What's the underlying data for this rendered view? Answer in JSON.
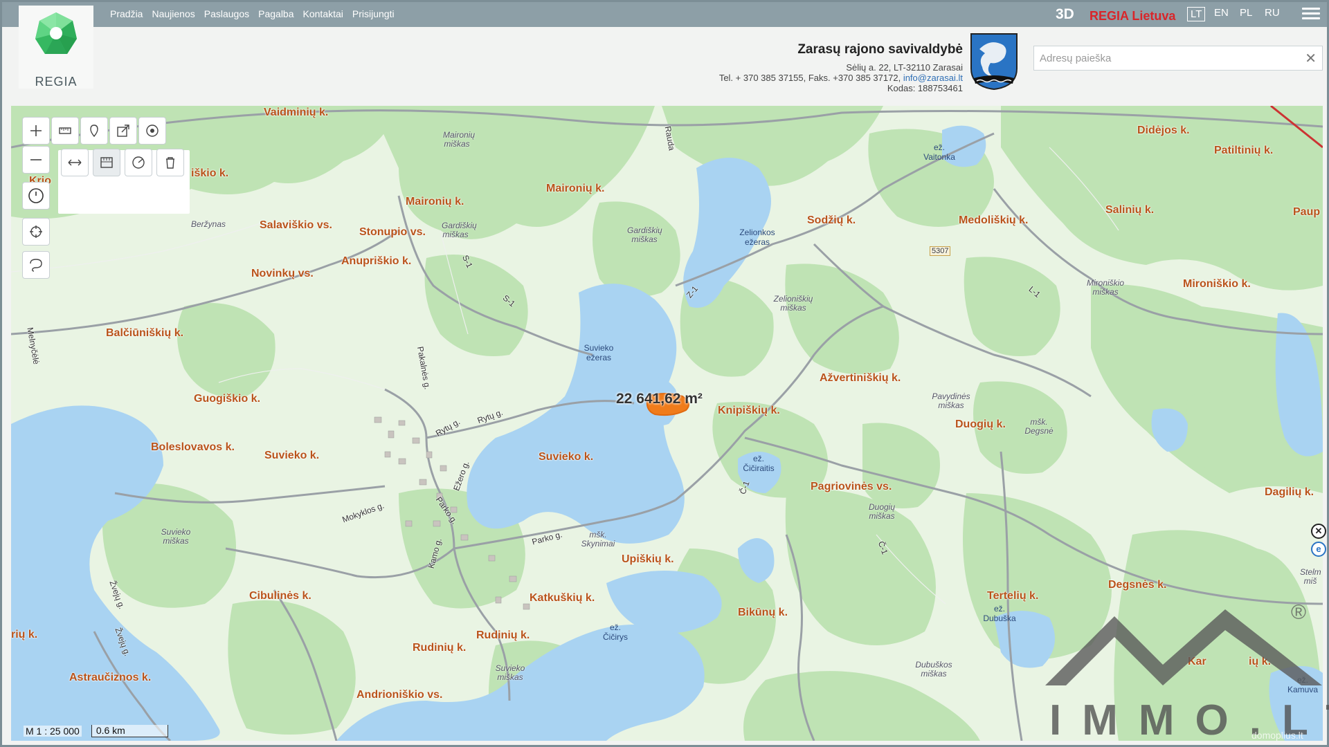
{
  "nav": {
    "items": [
      "Pradžia",
      "Naujienos",
      "Paslaugos",
      "Pagalba",
      "Kontaktai",
      "Prisijungti"
    ],
    "btn_3d": "3D",
    "regia_lietuva": "REGIA Lietuva",
    "languages": [
      "LT",
      "EN",
      "PL",
      "RU"
    ],
    "active_language": "LT"
  },
  "logo": {
    "text": "REGIA"
  },
  "municipality": {
    "name": "Zarasų rajono savivaldybė",
    "address": "Sėlių a. 22, LT-32110 Zarasai",
    "tel_text": "Tel. + 370 385 37155, Faks. +370 385 37172,",
    "email": "info@zarasai.lt",
    "code": "Kodas: 188753461"
  },
  "search": {
    "placeholder": "Adresų paieška",
    "clear": "✕"
  },
  "map": {
    "area_label": "22 641,62 m²",
    "scale_text": "M 1 : 25 000",
    "scale_bar": "0.6 km",
    "villages": [
      "Vaidminių k.",
      "Didėjos k.",
      "Patiltinių k.",
      "Krio",
      "iškio k.",
      "Maironių k.",
      "Maironių k.",
      "Salinių k.",
      "Paup",
      "Salaviškio vs.",
      "Stonupio vs.",
      "Sodžių k.",
      "Medoliškių k.",
      "Anupriškio k.",
      "Novinkų vs.",
      "Mironiškio k.",
      "Balčiūniškių k.",
      "Ažvertiniškių k.",
      "Guogiškio k.",
      "Knipiškių k.",
      "Duogių k.",
      "Boleslovavos k.",
      "Suvieko k.",
      "Suvieko k.",
      "Pagriovinės vs.",
      "Dagilių k.",
      "Upiškių k.",
      "Cibulinės k.",
      "Katkuškių k.",
      "Bikūnų k.",
      "Tertelių k.",
      "Degsnės k.",
      "rių k.",
      "Rudinių k.",
      "Rudinių k.",
      "Kar",
      "ių k.",
      "Astraučiznos k.",
      "Andrioniškio vs."
    ],
    "forests": [
      "Maironių miškas",
      "Beržynas",
      "Gardiškių miškas",
      "Gardiškių miškas",
      "Zelioniškių miškas",
      "Mironiškio miškas",
      "Pavydinės miškas",
      "mšk. Degsnė",
      "Suvieko miškas",
      "mšk. Skynimai",
      "Duogių miškas",
      "Suvieko miškas",
      "Dubuškos miškas",
      "Stelm miš"
    ],
    "lakes": [
      "ež. Vaitonka",
      "Zelionkos ežeras",
      "Suvieko ežeras",
      "ež. Čičiraitis",
      "ež. Čičirys",
      "ež. Dubuška",
      "ež. Kamuva"
    ],
    "roads": [
      "Rauda",
      "S-1",
      "S-1",
      "Z-1",
      "L-1",
      "Melnyčėlė",
      "Pakalnės g.",
      "Rytų g.",
      "Rytų g.",
      "Ežero g.",
      "Mokyklos g.",
      "Parko g.",
      "Parko g.",
      "Kamo g.",
      "Žvejų g.",
      "Žvejų g.",
      "Č-1",
      "Č-1",
      "5307"
    ]
  },
  "watermark": {
    "text": "IMMO.LT",
    "reg": "®",
    "site": "domoplius.lt"
  },
  "colors": {
    "topbar": "#8d9fa7",
    "forest": "#bfe3b4",
    "water": "#a9d3f2",
    "label": "#b9531a",
    "accent": "#d9252a"
  }
}
